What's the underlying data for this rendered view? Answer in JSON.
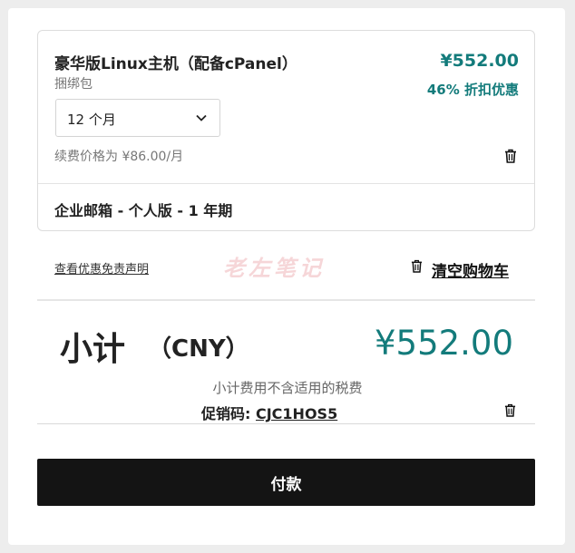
{
  "cart_item": {
    "title": "豪华版Linux主机（配备cPanel）",
    "subtitle": "捆绑包",
    "price": "¥552.00",
    "discount": "46% 折扣优惠",
    "term_selected": "12 个月",
    "renewal_text": "续费价格为 ¥86.00/月",
    "addon": "企业邮箱 - 个人版 - 1 年期"
  },
  "links": {
    "disclaimer": "查看优惠免责声明",
    "clear_cart": "清空购物车"
  },
  "watermark": "老左笔记",
  "summary": {
    "subtotal_label": "小计",
    "currency": "（CNY）",
    "total": "¥552.00",
    "tax_note": "小计费用不含适用的税费",
    "promo_label": "促销码:",
    "promo_code": "CJC1HOS5"
  },
  "pay_button": "付款",
  "colors": {
    "accent": "#137b7b",
    "button_bg": "#141414"
  }
}
